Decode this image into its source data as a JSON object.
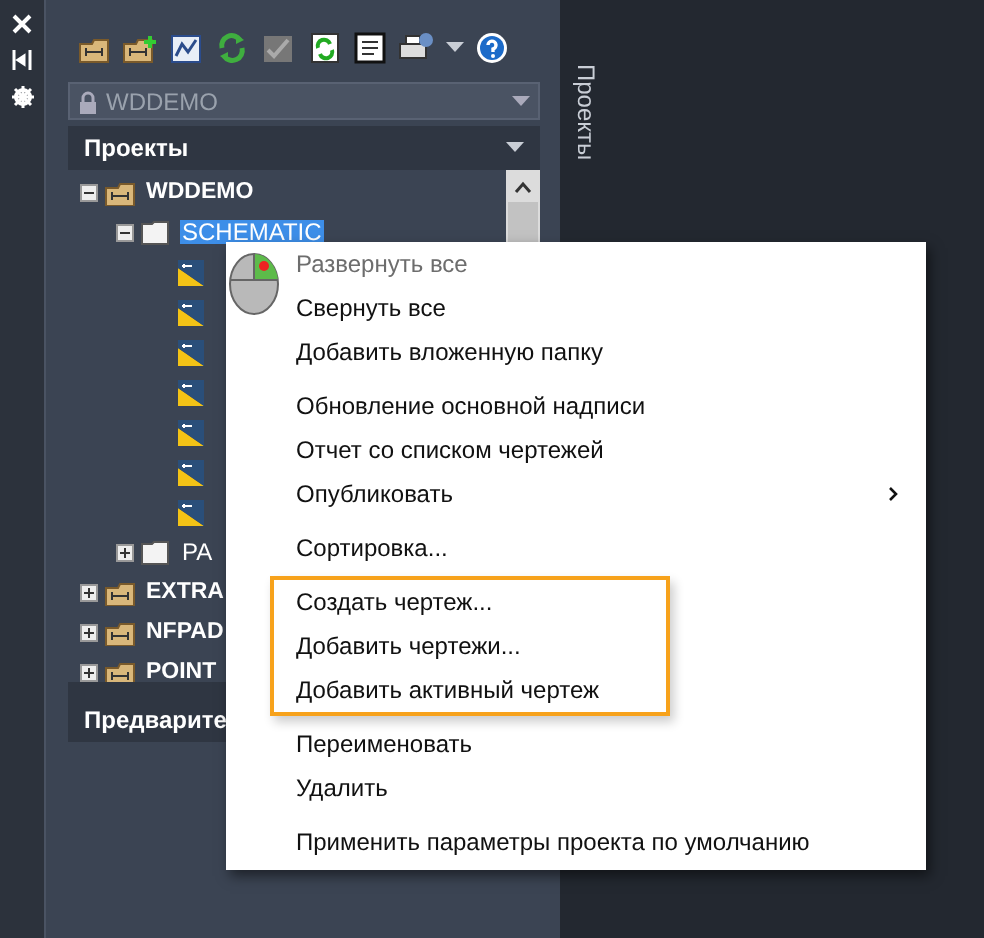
{
  "side_strip": {
    "buttons": [
      {
        "kind": "close"
      },
      {
        "kind": "pin"
      },
      {
        "kind": "settings"
      }
    ]
  },
  "toolbar": {
    "buttons": [
      {
        "kind": "open-project"
      },
      {
        "kind": "new-project"
      },
      {
        "kind": "new-drawing"
      },
      {
        "kind": "refresh"
      },
      {
        "kind": "tasks"
      },
      {
        "kind": "update"
      },
      {
        "kind": "report"
      },
      {
        "kind": "print"
      },
      {
        "kind": "dropdown"
      },
      {
        "kind": "help"
      }
    ]
  },
  "project_selector": {
    "value": "WDDEMO",
    "locked": true
  },
  "projects_header": {
    "title": "Проекты"
  },
  "tree": {
    "items": [
      {
        "label": "WDDEMO",
        "kind": "project",
        "expanded": true,
        "selected": false,
        "children": [
          {
            "label": "SCHEMATIC",
            "kind": "folder",
            "expanded": true,
            "selected": true,
            "children": [
              {
                "kind": "drawing",
                "selected": false
              },
              {
                "kind": "drawing",
                "selected": false
              },
              {
                "kind": "drawing",
                "selected": false
              },
              {
                "kind": "drawing",
                "selected": false
              },
              {
                "kind": "drawing",
                "selected": false
              },
              {
                "kind": "drawing",
                "selected": false
              },
              {
                "kind": "drawing",
                "selected": false
              }
            ]
          },
          {
            "label": "PA",
            "kind": "folder",
            "expanded": false,
            "selected": false
          }
        ]
      },
      {
        "label": "EXTRA",
        "kind": "project",
        "expanded": false,
        "selected": false
      },
      {
        "label": "NFPAD",
        "kind": "project",
        "expanded": false,
        "selected": false
      },
      {
        "label": "POINT",
        "kind": "project",
        "expanded": false,
        "selected": false
      }
    ]
  },
  "preview_header": {
    "title": "Предварите"
  },
  "vertical_tab": {
    "label": "Проекты"
  },
  "context_menu": {
    "sections": [
      {
        "highlighted": false,
        "items": [
          {
            "label": "Развернуть все",
            "disabled": true
          },
          {
            "label": "Свернуть все",
            "disabled": false
          },
          {
            "label": "Добавить вложенную папку",
            "disabled": false
          }
        ]
      },
      {
        "highlighted": false,
        "items": [
          {
            "label": "Обновление основной надписи",
            "disabled": false
          },
          {
            "label": "Отчет со списком чертежей",
            "disabled": false
          },
          {
            "label": "Опубликовать",
            "disabled": false,
            "submenu": true
          }
        ]
      },
      {
        "highlighted": false,
        "items": [
          {
            "label": "Сортировка...",
            "disabled": false
          }
        ]
      },
      {
        "highlighted": true,
        "items": [
          {
            "label": "Создать чертеж...",
            "disabled": false
          },
          {
            "label": "Добавить чертежи...",
            "disabled": false
          },
          {
            "label": "Добавить активный чертеж",
            "disabled": false
          }
        ]
      },
      {
        "highlighted": false,
        "items": [
          {
            "label": "Переименовать",
            "disabled": false
          },
          {
            "label": "Удалить",
            "disabled": false
          }
        ]
      },
      {
        "highlighted": false,
        "items": [
          {
            "label": "Применить параметры проекта по умолчанию",
            "disabled": false
          }
        ]
      }
    ]
  }
}
